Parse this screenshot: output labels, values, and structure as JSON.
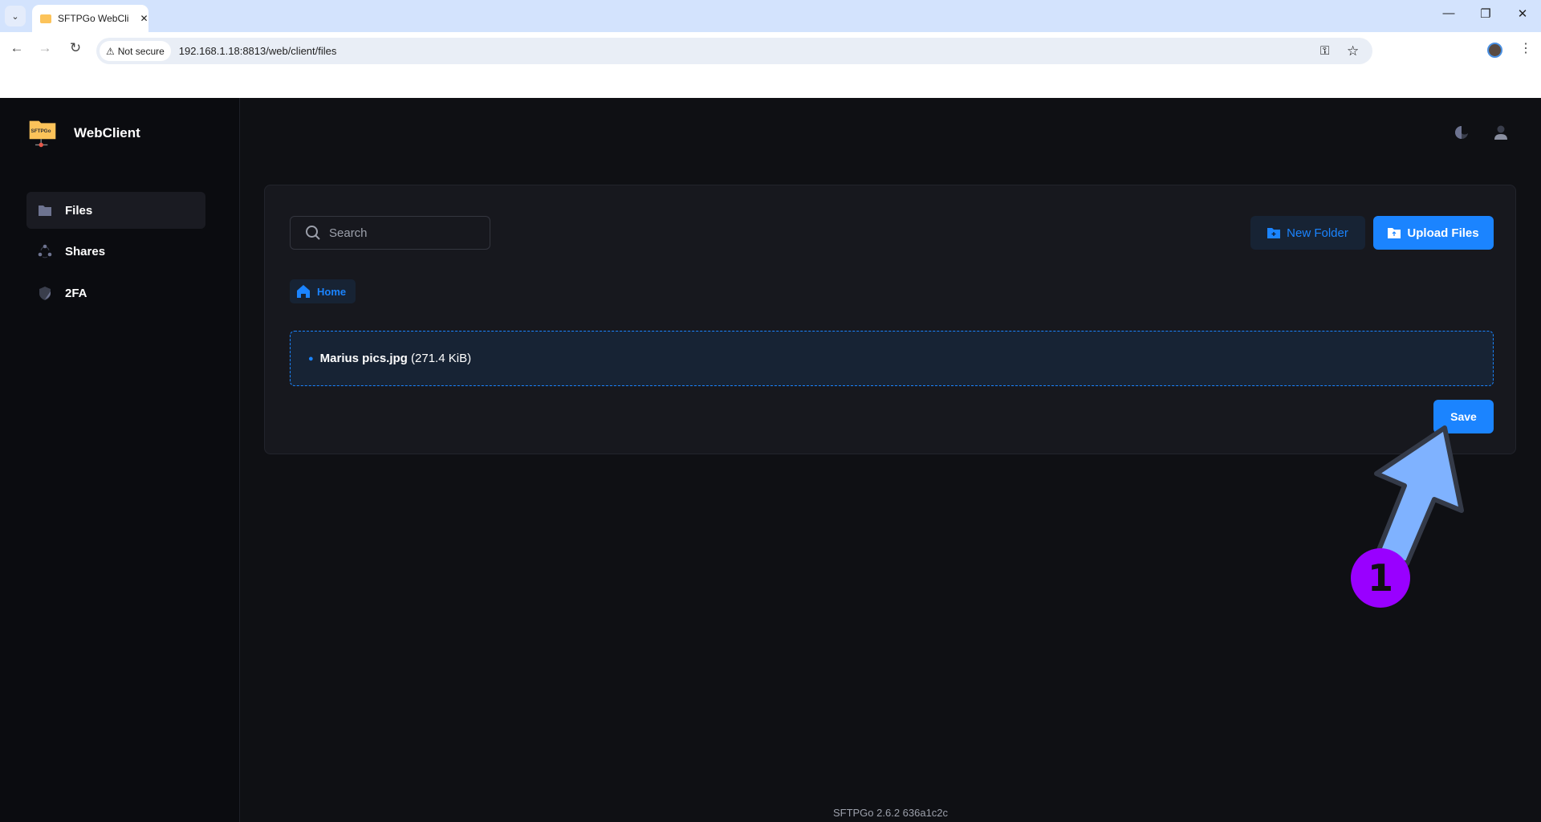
{
  "browser": {
    "tab_title": "SFTPGo WebCli",
    "security_label": "Not secure",
    "url": "192.168.1.18:8813/web/client/files"
  },
  "sidebar": {
    "brand": "WebClient",
    "logo_text": "SFTPGo",
    "items": [
      {
        "label": "Files",
        "icon": "folder-icon",
        "active": true
      },
      {
        "label": "Shares",
        "icon": "share-icon",
        "active": false
      },
      {
        "label": "2FA",
        "icon": "shield-icon",
        "active": false
      }
    ]
  },
  "main": {
    "search_placeholder": "Search",
    "new_folder_label": "New Folder",
    "upload_label": "Upload Files",
    "breadcrumb_home": "Home",
    "upload_list": [
      {
        "name": "Marius pics.jpg",
        "size": "(271.4 KiB)"
      }
    ],
    "save_label": "Save"
  },
  "footer": {
    "version": "SFTPGo 2.6.2 636a1c2c"
  },
  "annotation": {
    "step": "1"
  },
  "colors": {
    "accent": "#1b84ff",
    "badge": "#9900ff",
    "arrow": "#7fb2ff"
  }
}
